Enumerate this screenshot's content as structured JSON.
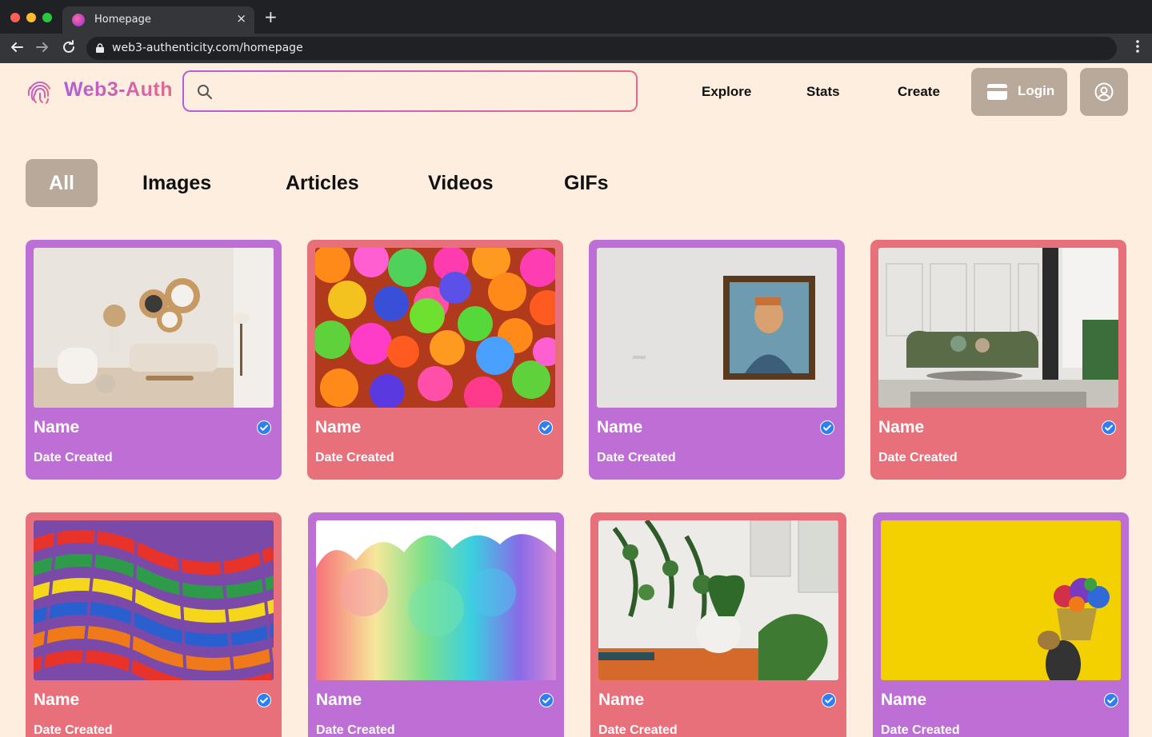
{
  "browser": {
    "tab_title": "Homepage",
    "tab_close": "×",
    "new_tab": "+",
    "url": "web3-authenticity.com/homepage"
  },
  "header": {
    "logo_text": "Web3-Auth",
    "search_placeholder": "",
    "nav": [
      "Explore",
      "Stats",
      "Create"
    ],
    "login_label": "Login"
  },
  "filters": {
    "items": [
      "All",
      "Images",
      "Articles",
      "Videos",
      "GIFs"
    ],
    "active": "All"
  },
  "cards": [
    {
      "name": "Name",
      "date": "Date Created",
      "image": "living-room-photo",
      "verified": true,
      "color": "#be6fd6"
    },
    {
      "name": "Name",
      "date": "Date Created",
      "image": "colorful-balls-photo",
      "verified": true,
      "color": "#e8707a"
    },
    {
      "name": "Name",
      "date": "Date Created",
      "image": "van-gogh-painting-photo",
      "verified": true,
      "color": "#be6fd6"
    },
    {
      "name": "Name",
      "date": "Date Created",
      "image": "green-sofa-photo",
      "verified": true,
      "color": "#e8707a"
    },
    {
      "name": "Name",
      "date": "Date Created",
      "image": "abstract-mosaic-photo",
      "verified": true,
      "color": "#e8707a"
    },
    {
      "name": "Name",
      "date": "Date Created",
      "image": "rainbow-smoke-photo",
      "verified": true,
      "color": "#be6fd6"
    },
    {
      "name": "Name",
      "date": "Date Created",
      "image": "plants-shelf-photo",
      "verified": true,
      "color": "#e8707a"
    },
    {
      "name": "Name",
      "date": "Date Created",
      "image": "yellow-wall-basket-photo",
      "verified": true,
      "color": "#be6fd6"
    }
  ],
  "colors": {
    "page_bg": "#fdeee0",
    "purple_card": "#be6fd6",
    "red_card": "#e8707a",
    "button_bg": "#b9a99a",
    "verified": "#2f7ff0"
  }
}
